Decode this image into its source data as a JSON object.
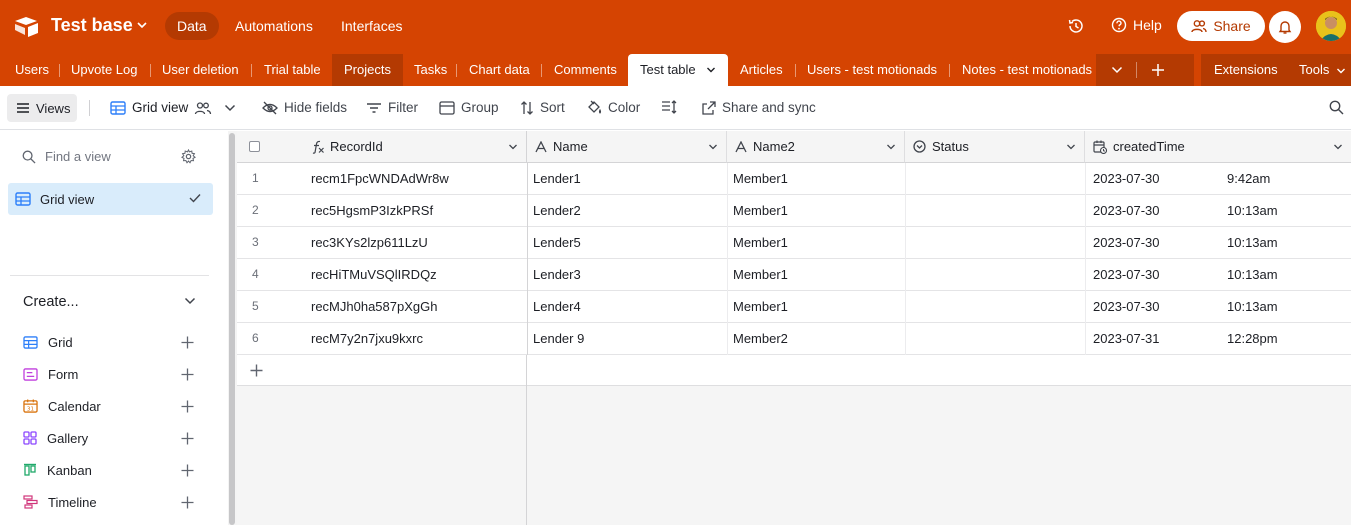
{
  "topbar": {
    "base_name": "Test base",
    "nav": [
      "Data",
      "Automations",
      "Interfaces"
    ],
    "active_nav": "Data",
    "help_label": "Help",
    "share_label": "Share",
    "brand_color": "#d54402"
  },
  "tabs": {
    "items": [
      "Users",
      "Upvote Log",
      "User deletion",
      "Trial table",
      "Projects",
      "Tasks",
      "Chart data",
      "Comments",
      "Test table",
      "Articles",
      "Users - test motionads",
      "Notes - test motionads"
    ],
    "active": "Test table",
    "extensions_label": "Extensions",
    "tools_label": "Tools"
  },
  "toolbar": {
    "views_label": "Views",
    "view_name": "Grid view",
    "hide_fields": "Hide fields",
    "filter": "Filter",
    "group": "Group",
    "sort": "Sort",
    "color": "Color",
    "share_sync": "Share and sync"
  },
  "sidebar": {
    "find_placeholder": "Find a view",
    "views": [
      {
        "label": "Grid view",
        "selected": true
      }
    ],
    "create_title": "Create...",
    "create_items": [
      {
        "label": "Grid",
        "icon": "grid-icon",
        "color": "#2d7ff9"
      },
      {
        "label": "Form",
        "icon": "form-icon",
        "color": "#c03fdd"
      },
      {
        "label": "Calendar",
        "icon": "calendar-icon",
        "color": "#d9730d"
      },
      {
        "label": "Gallery",
        "icon": "gallery-icon",
        "color": "#8b46ff"
      },
      {
        "label": "Kanban",
        "icon": "kanban-icon",
        "color": "#20a96a"
      },
      {
        "label": "Timeline",
        "icon": "timeline-icon",
        "color": "#d0357a"
      }
    ]
  },
  "grid": {
    "columns": [
      "RecordId",
      "Name",
      "Name2",
      "Status",
      "createdTime"
    ],
    "rows": [
      {
        "num": "1",
        "record_id": "recm1FpcWNDAdWr8w",
        "name": "Lender1",
        "name2": "Member1",
        "status": "",
        "date": "2023-07-30",
        "time": "9:42am"
      },
      {
        "num": "2",
        "record_id": "rec5HgsmP3IzkPRSf",
        "name": "Lender2",
        "name2": "Member1",
        "status": "",
        "date": "2023-07-30",
        "time": "10:13am"
      },
      {
        "num": "3",
        "record_id": "rec3KYs2lzp611LzU",
        "name": "Lender5",
        "name2": "Member1",
        "status": "",
        "date": "2023-07-30",
        "time": "10:13am"
      },
      {
        "num": "4",
        "record_id": "recHiTMuVSQlIRDQz",
        "name": "Lender3",
        "name2": "Member1",
        "status": "",
        "date": "2023-07-30",
        "time": "10:13am"
      },
      {
        "num": "5",
        "record_id": "recMJh0ha587pXgGh",
        "name": "Lender4",
        "name2": "Member1",
        "status": "",
        "date": "2023-07-30",
        "time": "10:13am"
      },
      {
        "num": "6",
        "record_id": "recM7y2n7jxu9kxrc",
        "name": "Lender 9",
        "name2": "Member2",
        "status": "",
        "date": "2023-07-31",
        "time": "12:28pm"
      }
    ]
  }
}
